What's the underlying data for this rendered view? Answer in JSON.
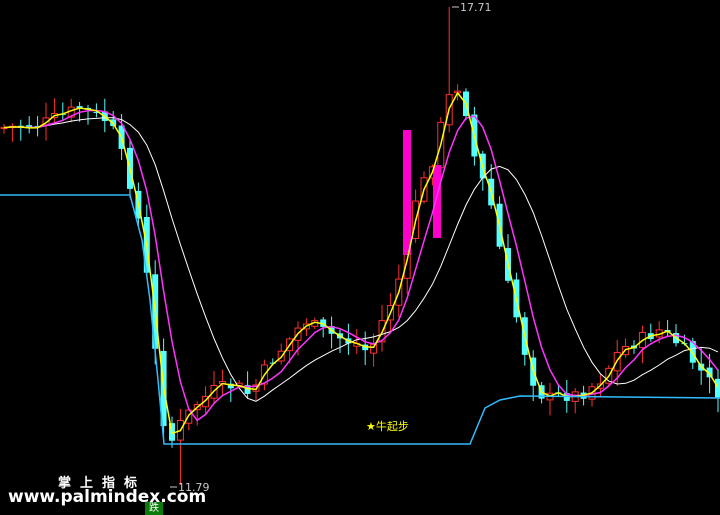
{
  "watermark": {
    "brand": "掌上指标",
    "site": "www.palmindex.com"
  },
  "signal": {
    "label": "★牛起步",
    "color": "#ffff00"
  },
  "bottom_marker": "跌",
  "colors": {
    "background": "#000000",
    "bull": "#ff3030",
    "bear": "#54ffff",
    "signal_bar": "#ff00cc",
    "ma_short": "#ffff00",
    "ma_mid": "#ff33ff",
    "ma_long": "#ffffff",
    "support": "#33bbff",
    "annotation": "#c8c8c8"
  },
  "chart_data": {
    "type": "candlestick",
    "price_annotations": {
      "high": "17.71",
      "low": "11.79"
    },
    "ylim": [
      11.3,
      18.0
    ],
    "series": []
  }
}
